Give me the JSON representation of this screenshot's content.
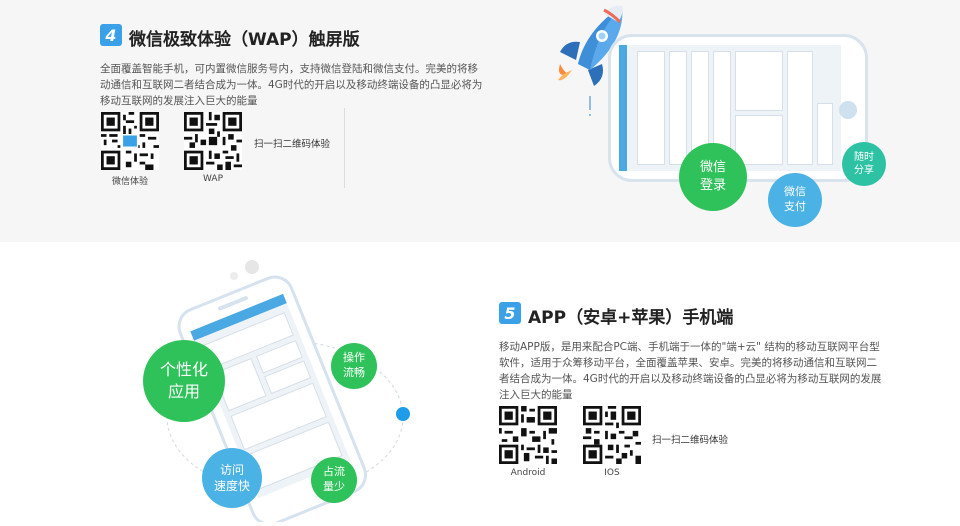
{
  "section4": {
    "badge": "4",
    "title": "微信极致体验（WAP）触屏版",
    "desc_line1": "全面覆盖智能手机，可内置微信服务号内，支持微信登陆和微信支付。完美的将移",
    "desc_line2": "动通信和互联网二者结合成为一体。4G时代的开启以及移动终端设备的凸显必将为",
    "desc_line3": "移动互联网的发展注入巨大的能量",
    "qr1_caption": "微信体验",
    "qr2_caption": "WAP",
    "scan_text": "扫一扫二维码体验",
    "bubble_login": [
      "微信",
      "登录"
    ],
    "bubble_pay": [
      "微信",
      "支付"
    ],
    "bubble_share": [
      "随时",
      "分享"
    ],
    "colors": {
      "accent": "#3aa0e8",
      "green": "#2fc25b",
      "blue": "#4ab2e5",
      "teal": "#2cc2a3"
    }
  },
  "section5": {
    "badge": "5",
    "title": "APP（安卓+苹果）手机端",
    "desc_line1": "移动APP版，是用来配合PC端、手机端于一体的\"端+云\" 结构的移动互联网平台型",
    "desc_line2": "软件，适用于众筹移动平台，全面覆盖苹果、安卓。完美的将移动通信和互联网二",
    "desc_line3": "者结合成为一体。4G时代的开启以及移动终端设备的凸显必将为移动互联网的发展",
    "desc_line4": "注入巨大的能量",
    "qr1_caption": "Android",
    "qr2_caption": "IOS",
    "scan_text": "扫一扫二维码体验",
    "bubble_personal": [
      "个性化",
      "应用"
    ],
    "bubble_smooth": [
      "操作",
      "流畅"
    ],
    "bubble_fast": [
      "访问",
      "速度快"
    ],
    "bubble_data": [
      "占流",
      "量少"
    ]
  }
}
